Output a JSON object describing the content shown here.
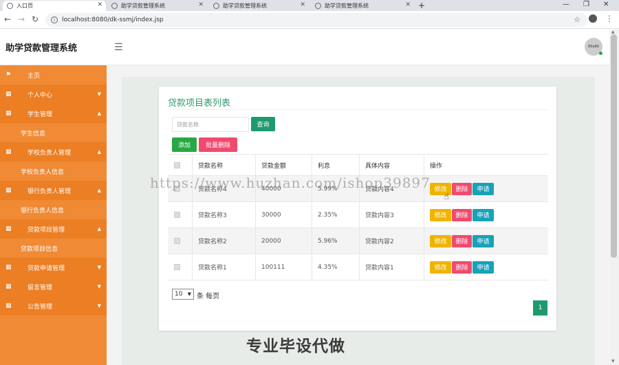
{
  "browser": {
    "tabs": [
      {
        "label": "入口页",
        "active": true
      },
      {
        "label": "助学贷款管理系统",
        "active": false
      },
      {
        "label": "助学贷款管理系统",
        "active": false
      },
      {
        "label": "助学贷款管理系统",
        "active": false
      }
    ],
    "url": "localhost:8080/dk-ssmj/index.jsp"
  },
  "header": {
    "title": "助学贷款管理系统",
    "avatar_text": "80x80"
  },
  "sidebar": {
    "items": [
      {
        "label": "主页",
        "icon": "flag-icon",
        "type": "main"
      },
      {
        "label": "个人中心",
        "icon": "grid-icon",
        "type": "group",
        "expanded": false
      },
      {
        "label": "学生管理",
        "icon": "grid-icon",
        "type": "group",
        "expanded": true
      },
      {
        "label": "学生信息",
        "type": "sub"
      },
      {
        "label": "学校负责人管理",
        "icon": "grid-icon",
        "type": "group",
        "expanded": true
      },
      {
        "label": "学校负责人信息",
        "type": "sub"
      },
      {
        "label": "银行负责人管理",
        "icon": "grid-icon",
        "type": "group",
        "expanded": true
      },
      {
        "label": "银行负责人信息",
        "type": "sub"
      },
      {
        "label": "贷款项目管理",
        "icon": "grid-icon",
        "type": "group",
        "expanded": true
      },
      {
        "label": "贷款项目信息",
        "type": "sub"
      },
      {
        "label": "贷款申请管理",
        "icon": "grid-icon",
        "type": "group",
        "expanded": false
      },
      {
        "label": "留言管理",
        "icon": "grid-icon",
        "type": "group",
        "expanded": false
      },
      {
        "label": "公告管理",
        "icon": "grid-icon",
        "type": "group",
        "expanded": false
      }
    ]
  },
  "main": {
    "card_title": "贷款项目表列表",
    "search_placeholder": "贷款名称",
    "search_btn": "查询",
    "add_btn": "添加",
    "batch_delete_btn": "批量删除",
    "table": {
      "columns": [
        "贷款名称",
        "贷款金额",
        "利息",
        "具体内容",
        "操作"
      ],
      "rows": [
        {
          "name": "贷款名称4",
          "amount": "40000",
          "interest": "5.99%",
          "content": "贷款内容4"
        },
        {
          "name": "贷款名称3",
          "amount": "30000",
          "interest": "2.35%",
          "content": "贷款内容3"
        },
        {
          "name": "贷款名称2",
          "amount": "20000",
          "interest": "5.96%",
          "content": "贷款内容2"
        },
        {
          "name": "贷款名称1",
          "amount": "100111",
          "interest": "4.35%",
          "content": "贷款内容1"
        }
      ],
      "actions": {
        "edit": "修改",
        "delete": "删除",
        "apply": "申请"
      }
    },
    "page_size": "10",
    "page_size_label": "条 每页",
    "current_page": "1"
  },
  "overlays": {
    "watermark": "https://www.huzhan.com/ishop39897",
    "caption": "专业毕设代做"
  }
}
